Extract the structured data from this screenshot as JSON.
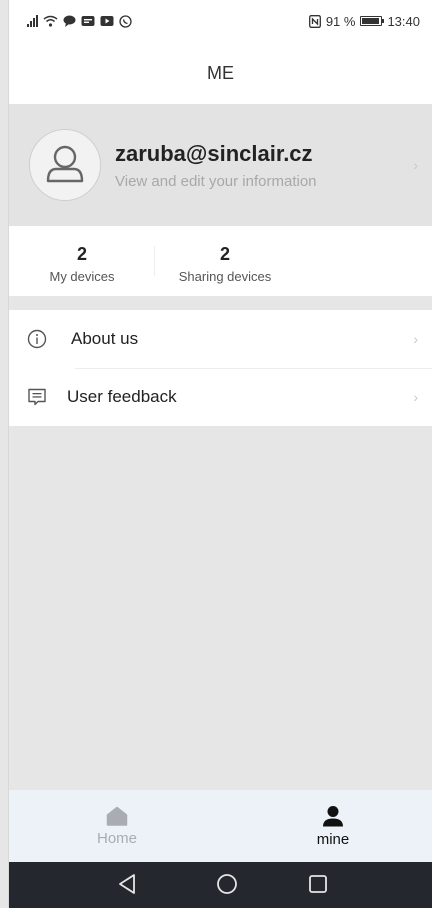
{
  "status_bar": {
    "battery_percent": "91 %",
    "time": "13:40"
  },
  "header": {
    "title": "ME"
  },
  "profile": {
    "email": "zaruba@sinclair.cz",
    "subtitle": "View and edit your information"
  },
  "stats": [
    {
      "value": "2",
      "label": "My devices"
    },
    {
      "value": "2",
      "label": "Sharing devices"
    }
  ],
  "menu": [
    {
      "label": "About us",
      "icon": "info-icon"
    },
    {
      "label": "User feedback",
      "icon": "feedback-icon"
    }
  ],
  "bottom_nav": [
    {
      "label": "Home",
      "icon": "home-icon",
      "active": false
    },
    {
      "label": "mine",
      "icon": "person-icon",
      "active": true
    }
  ],
  "colors": {
    "active_tab": "#111111",
    "inactive_tab": "#a9adb3",
    "bottom_nav_bg": "#edf2f9",
    "system_nav_bg": "#24272e"
  }
}
